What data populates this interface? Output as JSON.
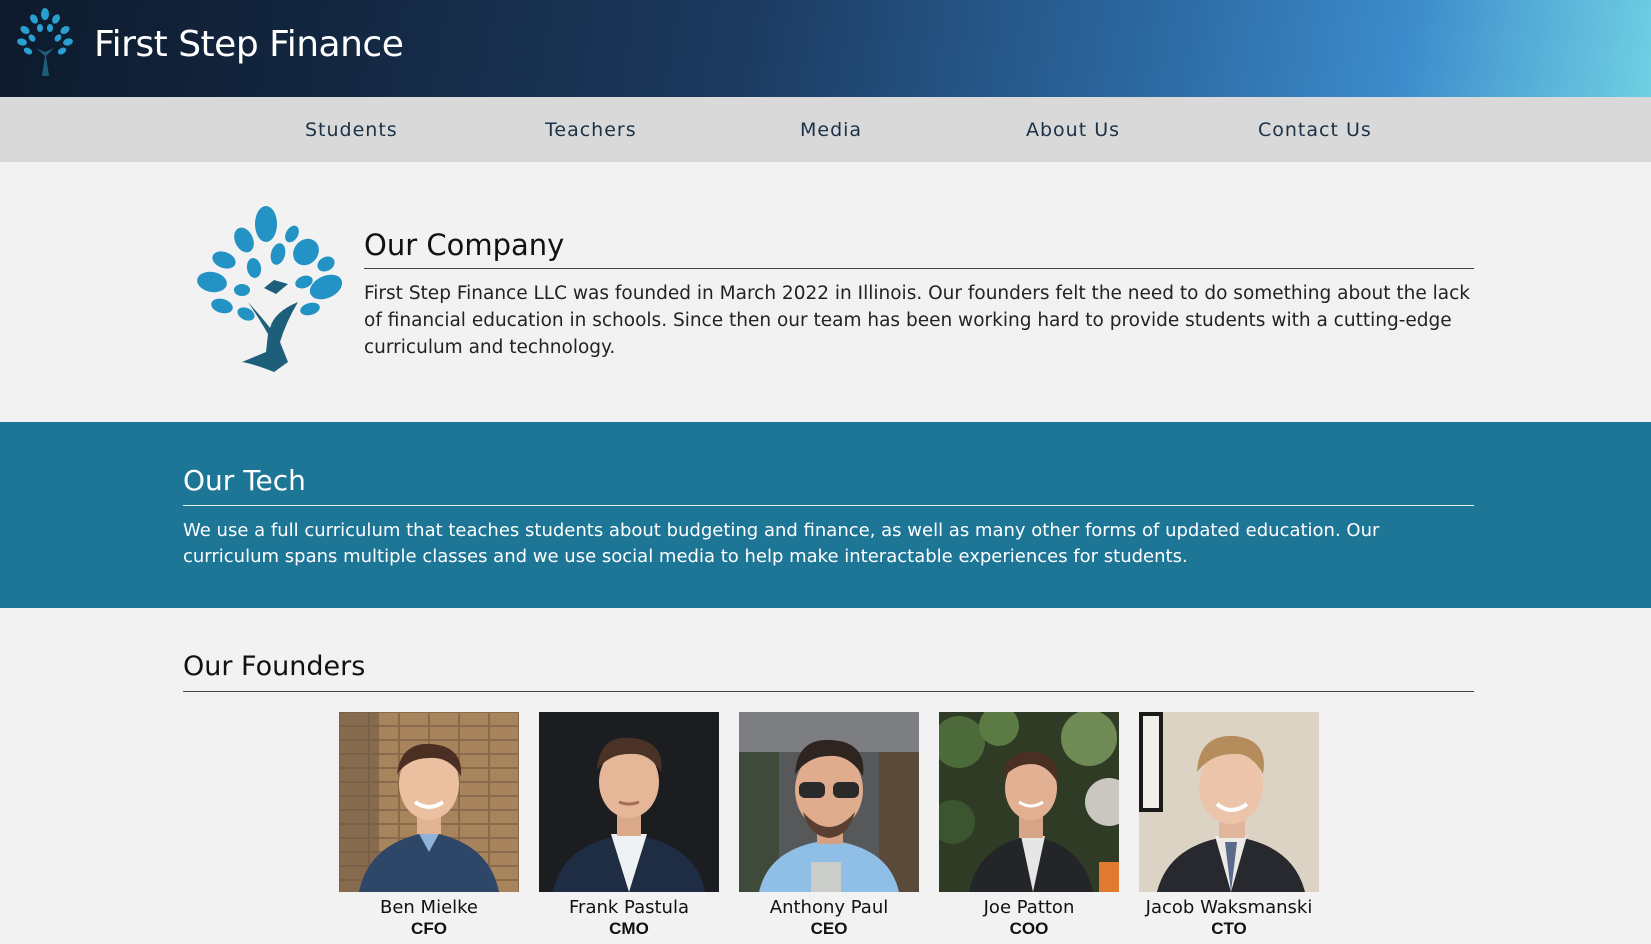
{
  "header": {
    "brand": "First Step Finance",
    "logo_icon": "tree-icon"
  },
  "nav": {
    "items": [
      {
        "label": "Students"
      },
      {
        "label": "Teachers"
      },
      {
        "label": "Media"
      },
      {
        "label": "About Us"
      },
      {
        "label": "Contact Us"
      }
    ]
  },
  "company": {
    "title": "Our Company",
    "text": "First Step Finance LLC was founded in March 2022 in Illinois. Our founders felt the need to do something about the lack of financial education in schools. Since then our team has been working hard to provide students with a cutting-edge curriculum and technology."
  },
  "tech": {
    "title": "Our Tech",
    "text": "We use a full curriculum that teaches students about budgeting and finance, as well as many other forms of updated education. Our curriculum spans multiple classes and we use social media to help make interactable experiences for students."
  },
  "founders": {
    "title": "Our Founders",
    "people": [
      {
        "name": "Ben Mielke",
        "role": "CFO"
      },
      {
        "name": "Frank Pastula",
        "role": "CMO"
      },
      {
        "name": "Anthony Paul",
        "role": "CEO"
      },
      {
        "name": "Joe Patton",
        "role": "COO"
      },
      {
        "name": "Jacob Waksmanski",
        "role": "CTO"
      }
    ]
  },
  "colors": {
    "accent_teal": "#1e7697",
    "logo_blue": "#2392c4",
    "logo_trunk": "#1d5f7b",
    "nav_bg": "#d9d9d9",
    "page_bg": "#f2f2f2"
  }
}
